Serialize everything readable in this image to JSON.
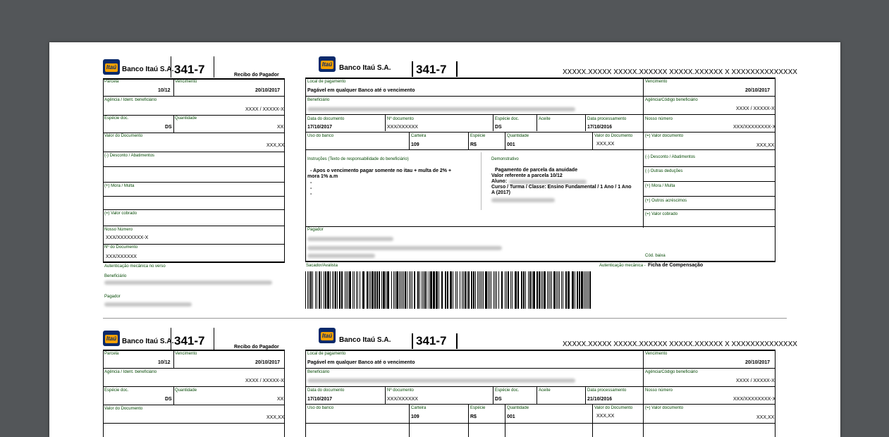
{
  "bank": {
    "name": "Banco Itaú S.A.",
    "code": "341-7",
    "logo_text": "Itaú"
  },
  "labels": {
    "recibo": "Recibo do Pagador",
    "parcela": "Parcela",
    "vencimento": "Vencimento",
    "agencia_ident": "Agência / Ident. beneficiário",
    "especie_doc": "Espécie doc.",
    "quantidade": "Quantidade",
    "valor_documento": "Valor do Documento",
    "desconto": "(-) Desconto / Abatimentos",
    "mora": "(+) Mora / Multa",
    "valor_cobrado": "(=) Valor cobrado",
    "nosso_numero": "Nosso Número",
    "n_documento": "Nº do Documento",
    "autenticacao_verso": "Autenticação mecânica no verso",
    "beneficiario": "Beneficiário",
    "pagador": "Pagador",
    "local_pagamento": "Local de pagamento",
    "agencia_codigo": "Agência/Código beneficiário",
    "data_documento": "Data do documento",
    "no_documento": "Nº documento",
    "especie_doc2": "Espécie doc.",
    "aceite": "Aceite",
    "data_processamento": "Data processamento",
    "nosso_numero2": "Nosso número",
    "uso_banco": "Uso do banco",
    "carteira": "Carteira",
    "especie": "Espécie",
    "valor_documento2": "(=) Valor documento",
    "instrucoes": "Instruções (Texto de responsabilidade do beneficiário)",
    "demonstrativo": "Demonstrativo",
    "outras_deducoes": "(-) Outras deduções",
    "outros_acrescimos": "(+) Outros acréscimos",
    "cod_baixa": "Cód. baixa",
    "sacador": "Sacador/Avalista",
    "autenticacao_ficha": "Autenticação mecânica -",
    "ficha": "Ficha de Compensação"
  },
  "values": {
    "linha_digitavel": "XXXXX.XXXXX XXXXX.XXXXXX XXXXX.XXXXXX X XXXXXXXXXXXXXX",
    "parcela": "10/12",
    "vencimento": "20/10/2017",
    "agencia": "XXXX / XXXXX-X",
    "especie_doc": "DS",
    "quantidade": "XX",
    "valor_documento": "XXX,XX",
    "nosso_numero_recibo": "XXX/XXXXXXXX-X",
    "n_documento": "XXX/XXXXXX",
    "local_pagamento": "Pagável em qualquer Banco até o vencimento",
    "agencia_codigo": "XXXX / XXXXX-X",
    "data_documento": "17/10/2017",
    "no_documento": "XXX/XXXXXX",
    "especie_doc2": "DS",
    "data_processamento": "17/10/2016",
    "data_processamento2": "21/10/2016",
    "nosso_numero": "XXX/XXXXXXXX-X",
    "carteira": "109",
    "especie": "R$",
    "quantidade2": "001",
    "valor_documento_mid": "XXX,XX",
    "instrucao_1": "- Apos o vencimento pagar somente no itau + multa de 2% +",
    "instrucao_2": "mora 1% a.m",
    "bullet": "-",
    "demo_1": "Pagamento de parcela da anuidade",
    "demo_2": "Valor referente a parcela 10/12",
    "demo_aluno": "Aluno:",
    "demo_3": "Curso / Turma / Classe: Ensino Fundamental / 1 Ano / 1 Ano",
    "demo_4": "A (2017)"
  }
}
